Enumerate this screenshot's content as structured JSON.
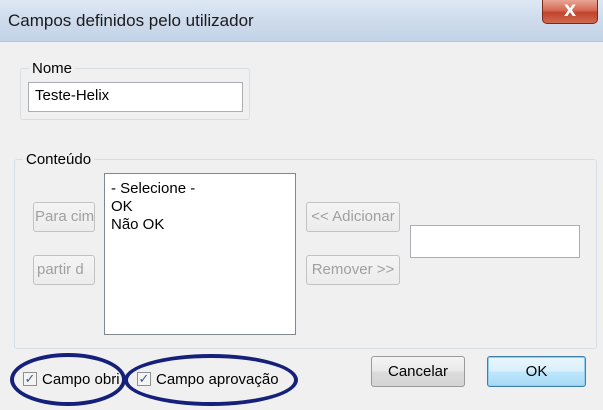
{
  "window": {
    "title": "Campos definidos pelo utilizador",
    "close_label": "X"
  },
  "nome": {
    "legend": "Nome",
    "value": "Teste-Helix"
  },
  "conteudo": {
    "legend": "Conteúdo",
    "move_up_label": "Para cim",
    "move_down_label": "partir d",
    "list_items": [
      "- Selecione -",
      "OK",
      "Não OK"
    ],
    "add_label": "<< Adicionar",
    "remove_label": "Remover >>",
    "new_item_value": ""
  },
  "options": {
    "campo_obrigatorio_label": "Campo obri",
    "campo_obrigatorio_checked": true,
    "campo_aprovacao_label": "Campo aprovação",
    "campo_aprovacao_checked": true,
    "check_mark": "✓"
  },
  "buttons": {
    "cancel_label": "Cancelar",
    "ok_label": "OK"
  },
  "colors": {
    "highlight_ellipse": "#14207a",
    "title_bar": "#cfdcec",
    "close_button": "#c2432b"
  }
}
